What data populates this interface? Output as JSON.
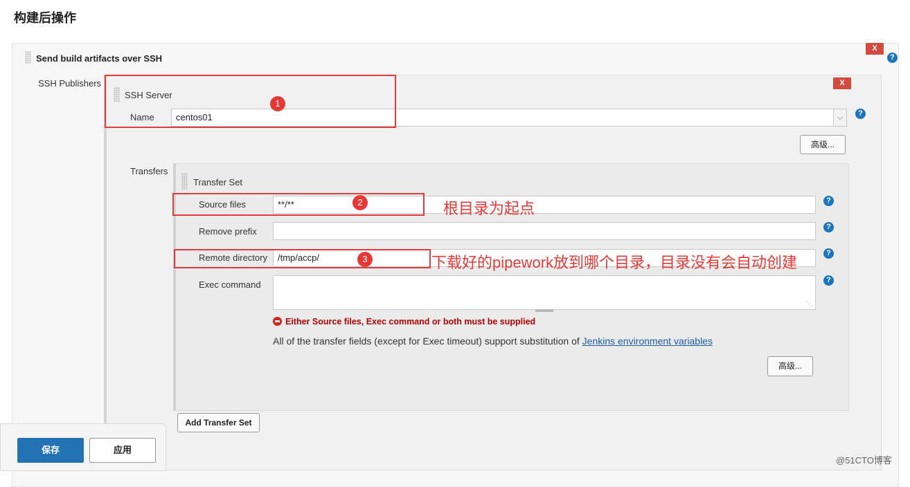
{
  "section_title": "构建后操作",
  "plugin": {
    "title": "Send build artifacts over SSH",
    "delete_label": "X",
    "help_label": "?"
  },
  "ssh_publishers": {
    "label": "SSH Publishers",
    "server": {
      "title": "SSH Server",
      "delete_label": "X",
      "name_label": "Name",
      "name_value": "centos01",
      "advanced_label": "高级..."
    },
    "transfers": {
      "label": "Transfers",
      "set_title": "Transfer Set",
      "source_files_label": "Source files",
      "source_files_value": "**/**",
      "remove_prefix_label": "Remove prefix",
      "remove_prefix_value": "",
      "remote_directory_label": "Remote directory",
      "remote_directory_value": "/tmp/accp/",
      "exec_command_label": "Exec command",
      "exec_command_value": "",
      "error_text": "Either Source files, Exec command or both must be supplied",
      "info_text": "All of the transfer fields (except for Exec timeout) support substitution of ",
      "info_link": "Jenkins environment variables",
      "advanced_label": "高级...",
      "add_transfer_label": "Add Transfer Set"
    }
  },
  "annotations": {
    "marker_1": "1",
    "marker_2": "2",
    "marker_3": "3",
    "note_2": "根目录为起点",
    "note_3": "下载好的pipework放到哪个目录，目录没有会自动创建"
  },
  "bottom_bar": {
    "save_label": "保存",
    "apply_label": "应用"
  },
  "watermark": "@51CTO博客",
  "colors": {
    "annotation_red": "#e53935",
    "primary_blue": "#2272b4",
    "delete_red": "#d24b3e",
    "error_red": "#b50000",
    "help_blue": "#1a75bc"
  }
}
